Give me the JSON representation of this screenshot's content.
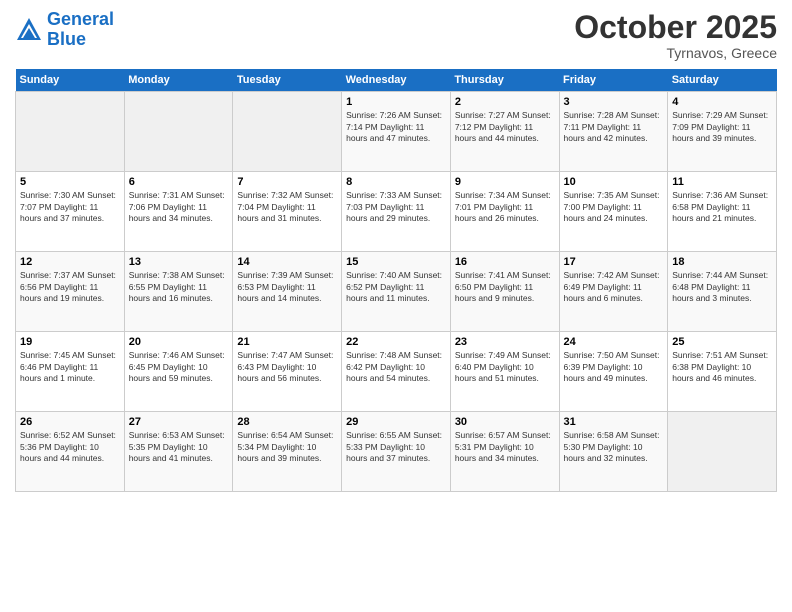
{
  "header": {
    "logo_line1": "General",
    "logo_line2": "Blue",
    "month": "October 2025",
    "location": "Tyrnavos, Greece"
  },
  "days_of_week": [
    "Sunday",
    "Monday",
    "Tuesday",
    "Wednesday",
    "Thursday",
    "Friday",
    "Saturday"
  ],
  "weeks": [
    [
      {
        "num": "",
        "text": ""
      },
      {
        "num": "",
        "text": ""
      },
      {
        "num": "",
        "text": ""
      },
      {
        "num": "1",
        "text": "Sunrise: 7:26 AM\nSunset: 7:14 PM\nDaylight: 11 hours and 47 minutes."
      },
      {
        "num": "2",
        "text": "Sunrise: 7:27 AM\nSunset: 7:12 PM\nDaylight: 11 hours and 44 minutes."
      },
      {
        "num": "3",
        "text": "Sunrise: 7:28 AM\nSunset: 7:11 PM\nDaylight: 11 hours and 42 minutes."
      },
      {
        "num": "4",
        "text": "Sunrise: 7:29 AM\nSunset: 7:09 PM\nDaylight: 11 hours and 39 minutes."
      }
    ],
    [
      {
        "num": "5",
        "text": "Sunrise: 7:30 AM\nSunset: 7:07 PM\nDaylight: 11 hours and 37 minutes."
      },
      {
        "num": "6",
        "text": "Sunrise: 7:31 AM\nSunset: 7:06 PM\nDaylight: 11 hours and 34 minutes."
      },
      {
        "num": "7",
        "text": "Sunrise: 7:32 AM\nSunset: 7:04 PM\nDaylight: 11 hours and 31 minutes."
      },
      {
        "num": "8",
        "text": "Sunrise: 7:33 AM\nSunset: 7:03 PM\nDaylight: 11 hours and 29 minutes."
      },
      {
        "num": "9",
        "text": "Sunrise: 7:34 AM\nSunset: 7:01 PM\nDaylight: 11 hours and 26 minutes."
      },
      {
        "num": "10",
        "text": "Sunrise: 7:35 AM\nSunset: 7:00 PM\nDaylight: 11 hours and 24 minutes."
      },
      {
        "num": "11",
        "text": "Sunrise: 7:36 AM\nSunset: 6:58 PM\nDaylight: 11 hours and 21 minutes."
      }
    ],
    [
      {
        "num": "12",
        "text": "Sunrise: 7:37 AM\nSunset: 6:56 PM\nDaylight: 11 hours and 19 minutes."
      },
      {
        "num": "13",
        "text": "Sunrise: 7:38 AM\nSunset: 6:55 PM\nDaylight: 11 hours and 16 minutes."
      },
      {
        "num": "14",
        "text": "Sunrise: 7:39 AM\nSunset: 6:53 PM\nDaylight: 11 hours and 14 minutes."
      },
      {
        "num": "15",
        "text": "Sunrise: 7:40 AM\nSunset: 6:52 PM\nDaylight: 11 hours and 11 minutes."
      },
      {
        "num": "16",
        "text": "Sunrise: 7:41 AM\nSunset: 6:50 PM\nDaylight: 11 hours and 9 minutes."
      },
      {
        "num": "17",
        "text": "Sunrise: 7:42 AM\nSunset: 6:49 PM\nDaylight: 11 hours and 6 minutes."
      },
      {
        "num": "18",
        "text": "Sunrise: 7:44 AM\nSunset: 6:48 PM\nDaylight: 11 hours and 3 minutes."
      }
    ],
    [
      {
        "num": "19",
        "text": "Sunrise: 7:45 AM\nSunset: 6:46 PM\nDaylight: 11 hours and 1 minute."
      },
      {
        "num": "20",
        "text": "Sunrise: 7:46 AM\nSunset: 6:45 PM\nDaylight: 10 hours and 59 minutes."
      },
      {
        "num": "21",
        "text": "Sunrise: 7:47 AM\nSunset: 6:43 PM\nDaylight: 10 hours and 56 minutes."
      },
      {
        "num": "22",
        "text": "Sunrise: 7:48 AM\nSunset: 6:42 PM\nDaylight: 10 hours and 54 minutes."
      },
      {
        "num": "23",
        "text": "Sunrise: 7:49 AM\nSunset: 6:40 PM\nDaylight: 10 hours and 51 minutes."
      },
      {
        "num": "24",
        "text": "Sunrise: 7:50 AM\nSunset: 6:39 PM\nDaylight: 10 hours and 49 minutes."
      },
      {
        "num": "25",
        "text": "Sunrise: 7:51 AM\nSunset: 6:38 PM\nDaylight: 10 hours and 46 minutes."
      }
    ],
    [
      {
        "num": "26",
        "text": "Sunrise: 6:52 AM\nSunset: 5:36 PM\nDaylight: 10 hours and 44 minutes."
      },
      {
        "num": "27",
        "text": "Sunrise: 6:53 AM\nSunset: 5:35 PM\nDaylight: 10 hours and 41 minutes."
      },
      {
        "num": "28",
        "text": "Sunrise: 6:54 AM\nSunset: 5:34 PM\nDaylight: 10 hours and 39 minutes."
      },
      {
        "num": "29",
        "text": "Sunrise: 6:55 AM\nSunset: 5:33 PM\nDaylight: 10 hours and 37 minutes."
      },
      {
        "num": "30",
        "text": "Sunrise: 6:57 AM\nSunset: 5:31 PM\nDaylight: 10 hours and 34 minutes."
      },
      {
        "num": "31",
        "text": "Sunrise: 6:58 AM\nSunset: 5:30 PM\nDaylight: 10 hours and 32 minutes."
      },
      {
        "num": "",
        "text": ""
      }
    ]
  ]
}
